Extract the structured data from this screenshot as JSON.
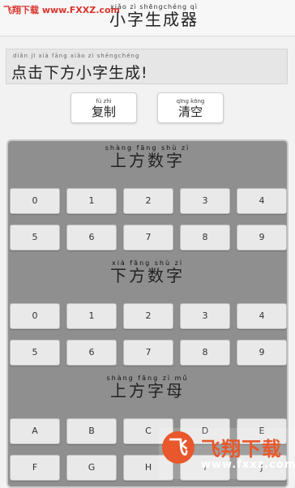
{
  "header": {
    "site_tag": "飞翔下载 www.FXXZ.com",
    "title_pinyin": "xiǎo zì shēngchéng qì",
    "title": "小字生成器"
  },
  "output": {
    "pinyin": "diǎn jī xià fāng xiǎo zì shēngchéng",
    "text": "点击下方小字生成!"
  },
  "buttons": {
    "copy_pinyin": "fù zhì",
    "copy": "复制",
    "clear_pinyin": "qīng kōng",
    "clear": "清空"
  },
  "sections": [
    {
      "pinyin": "shàng fāng shù zì",
      "title": "上方数字",
      "rows": [
        [
          "0",
          "1",
          "2",
          "3",
          "4"
        ],
        [
          "5",
          "6",
          "7",
          "8",
          "9"
        ]
      ]
    },
    {
      "pinyin": "xià fāng shù zì",
      "title": "下方数字",
      "rows": [
        [
          "0",
          "1",
          "2",
          "3",
          "4"
        ],
        [
          "5",
          "6",
          "7",
          "8",
          "9"
        ]
      ]
    },
    {
      "pinyin": "shàng fāng zì mǔ",
      "title": "上方字母",
      "rows": [
        [
          "A",
          "B",
          "C",
          "D",
          "E"
        ],
        [
          "F",
          "G",
          "H",
          "I",
          "J"
        ]
      ]
    }
  ],
  "watermark": {
    "logo_glyph": "飞",
    "text": "飞翔下载",
    "url": "www.fxxz.com"
  },
  "colors": {
    "accent": "#d8342c",
    "panel": "#8f8f8f",
    "logo": "#e8582c"
  }
}
